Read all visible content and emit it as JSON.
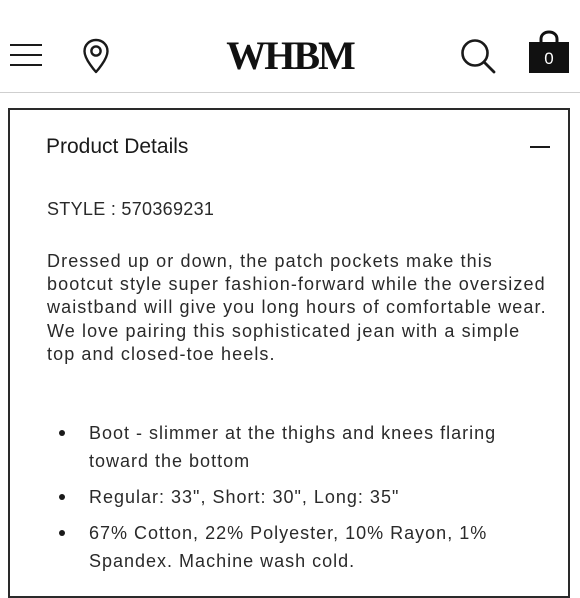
{
  "header": {
    "logo": "WHBM",
    "menu_icon": "hamburger-menu-icon",
    "location_icon": "map-pin-icon",
    "search_icon": "search-icon",
    "bag_icon": "shopping-bag-icon",
    "bag_count": "0"
  },
  "product_details": {
    "title": "Product Details",
    "toggle_icon": "minus-collapse-icon",
    "style_line": "STYLE : 570369231",
    "description": "Dressed up or down, the patch pockets make this bootcut style super fashion-forward while the oversized waistband will give you long hours of comfortable wear. We love pairing this sophisticated jean with a simple top and closed-toe heels.",
    "bullets": [
      "Boot - slimmer at the thighs and knees flaring toward the bottom",
      "Regular: 33\", Short: 30\", Long: 35\"",
      "67% Cotton, 22% Polyester, 10% Rayon, 1% Spandex. Machine wash cold."
    ]
  }
}
